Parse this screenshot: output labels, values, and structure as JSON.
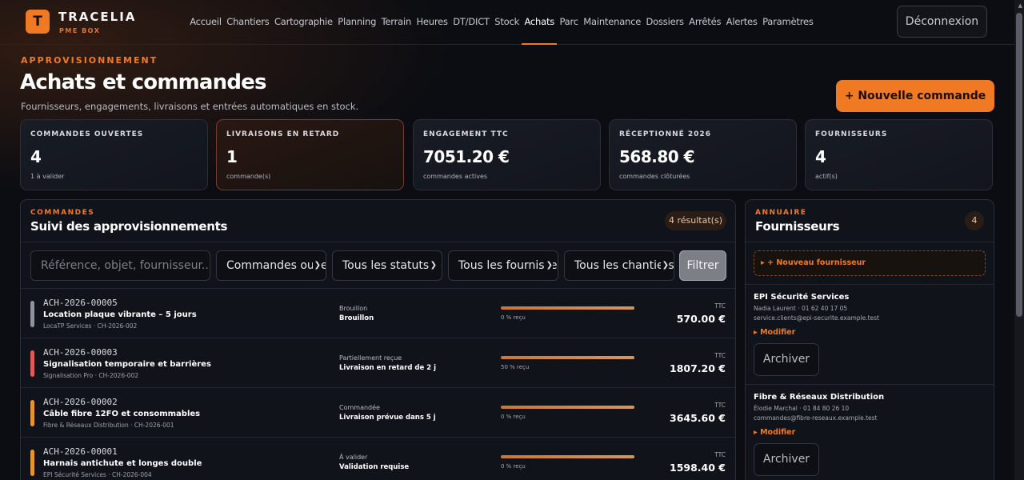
{
  "app": {
    "logo_letter": "T",
    "brand": "TRACELIA",
    "brand_sub": "PME BOX",
    "logout_label": "Déconnexion"
  },
  "nav": [
    {
      "label": "Accueil",
      "active": false
    },
    {
      "label": "Chantiers",
      "active": false
    },
    {
      "label": "Cartographie",
      "active": false
    },
    {
      "label": "Planning",
      "active": false
    },
    {
      "label": "Terrain",
      "active": false
    },
    {
      "label": "Heures",
      "active": false
    },
    {
      "label": "DT/DICT",
      "active": false
    },
    {
      "label": "Stock",
      "active": false
    },
    {
      "label": "Achats",
      "active": true
    },
    {
      "label": "Parc",
      "active": false
    },
    {
      "label": "Maintenance",
      "active": false
    },
    {
      "label": "Dossiers",
      "active": false
    },
    {
      "label": "Arrêtés",
      "active": false
    },
    {
      "label": "Alertes",
      "active": false
    },
    {
      "label": "Paramètres",
      "active": false
    }
  ],
  "header": {
    "eyebrow": "APPROVISIONNEMENT",
    "title": "Achats et commandes",
    "subtitle": "Fournisseurs, engagements, livraisons et entrées automatiques en stock.",
    "new_order_label": "+ Nouvelle commande"
  },
  "stats": [
    {
      "label": "COMMANDES OUVERTES",
      "value": "4",
      "note": "1 à valider",
      "alert": false
    },
    {
      "label": "LIVRAISONS EN RETARD",
      "value": "1",
      "note": "commande(s)",
      "alert": true
    },
    {
      "label": "ENGAGEMENT TTC",
      "value": "7051.20 €",
      "note": "commandes actives",
      "alert": false
    },
    {
      "label": "RÉCEPTIONNÉ 2026",
      "value": "568.80 €",
      "note": "commandes clôturées",
      "alert": false
    },
    {
      "label": "FOURNISSEURS",
      "value": "4",
      "note": "actif(s)",
      "alert": false
    }
  ],
  "orders": {
    "eyebrow": "COMMANDES",
    "title": "Suivi des approvisionnements",
    "result_count": "4 résultat(s)",
    "filters": {
      "search_placeholder": "Référence, objet, fournisseur...",
      "scope": "Commandes ouvertes",
      "status": "Tous les statuts",
      "supplier": "Tous les fournisseurs",
      "site": "Tous les chantiers",
      "button": "Filtrer"
    },
    "rows": [
      {
        "ref": "ACH-2026-00005",
        "object": "Location plaque vibrante – 5 jours",
        "meta": "LocaTP Services · CH-2026-002",
        "status": "Brouillon",
        "detail": "Brouillon",
        "received_pct": 0,
        "received_label": "0 % reçu",
        "ttc_label": "TTC",
        "amount": "570.00 €",
        "color": "#8f939c"
      },
      {
        "ref": "ACH-2026-00003",
        "object": "Signalisation temporaire et barrières",
        "meta": "Signalisation Pro · CH-2026-002",
        "status": "Partiellement reçue",
        "detail": "Livraison en retard de 2 j",
        "received_pct": 50,
        "received_label": "50 % reçu",
        "ttc_label": "TTC",
        "amount": "1807.20 €",
        "color": "#e05a5a"
      },
      {
        "ref": "ACH-2026-00002",
        "object": "Câble fibre 12FO et consommables",
        "meta": "Fibre & Réseaux Distribution · CH-2026-001",
        "status": "Commandée",
        "detail": "Livraison prévue dans 5 j",
        "received_pct": 0,
        "received_label": "0 % reçu",
        "ttc_label": "TTC",
        "amount": "3645.60 €",
        "color": "#e8942e"
      },
      {
        "ref": "ACH-2026-00001",
        "object": "Harnais antichute et longes double",
        "meta": "EPI Sécurité Services · CH-2026-004",
        "status": "À valider",
        "detail": "Validation requise",
        "received_pct": 0,
        "received_label": "0 % reçu",
        "ttc_label": "TTC",
        "amount": "1598.40 €",
        "color": "#e8942e"
      }
    ]
  },
  "suppliers": {
    "eyebrow": "ANNUAIRE",
    "title": "Fournisseurs",
    "count": "4",
    "new_label": "+ Nouveau fournisseur",
    "items": [
      {
        "name": "EPI Sécurité Services",
        "contact": "Nadia Laurent · 01 62 40 17 05",
        "email": "service.clients@epi-securite.example.test",
        "edit_label": "Modifier",
        "archive_label": "Archiver"
      },
      {
        "name": "Fibre & Réseaux Distribution",
        "contact": "Élodie Marchal · 01 84 80 26 10",
        "email": "commandes@fibre-reseaux.example.test",
        "edit_label": "Modifier",
        "archive_label": "Archiver"
      }
    ]
  },
  "colors": {
    "accent": "#f07a24",
    "background": "#0b0d12",
    "danger": "#e05a5a"
  }
}
